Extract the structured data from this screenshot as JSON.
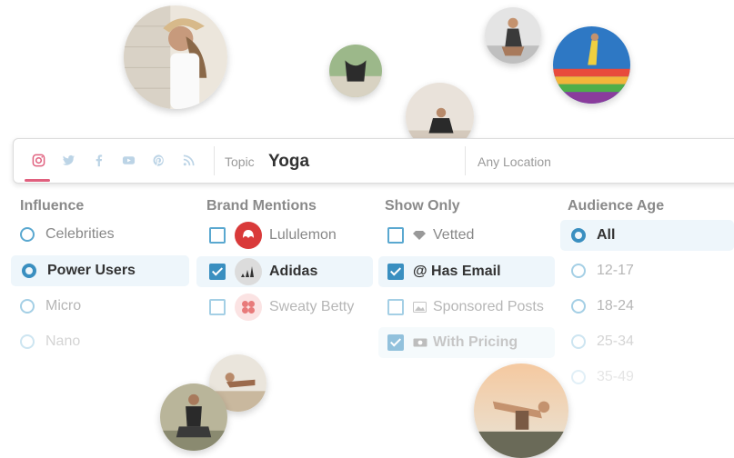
{
  "search": {
    "networks": [
      "instagram-icon",
      "twitter-icon",
      "facebook-icon",
      "youtube-icon",
      "pinterest-icon",
      "rss-icon"
    ],
    "topic_label": "Topic",
    "topic_value": "Yoga",
    "location_placeholder": "Any Location"
  },
  "filters": {
    "influence": {
      "title": "Influence",
      "options": [
        {
          "label": "Celebrities",
          "selected": false
        },
        {
          "label": "Power Users",
          "selected": true
        },
        {
          "label": "Micro",
          "selected": false
        },
        {
          "label": "Nano",
          "selected": false
        }
      ]
    },
    "brand_mentions": {
      "title": "Brand Mentions",
      "options": [
        {
          "label": "Lululemon",
          "checked": false,
          "icon": "lululemon-logo"
        },
        {
          "label": "Adidas",
          "checked": true,
          "icon": "adidas-logo"
        },
        {
          "label": "Sweaty Betty",
          "checked": false,
          "icon": "sweaty-betty-logo"
        }
      ]
    },
    "show_only": {
      "title": "Show Only",
      "options": [
        {
          "label": "Vetted",
          "checked": false,
          "icon": "diamond-icon"
        },
        {
          "label": "@ Has Email",
          "checked": true
        },
        {
          "label": "Sponsored Posts",
          "checked": false,
          "icon": "image-icon"
        },
        {
          "label": "With Pricing",
          "checked": true,
          "icon": "money-icon"
        }
      ]
    },
    "audience_age": {
      "title": "Audience Age",
      "options": [
        {
          "label": "All",
          "selected": true
        },
        {
          "label": "12-17",
          "selected": false
        },
        {
          "label": "18-24",
          "selected": false
        },
        {
          "label": "25-34",
          "selected": false
        },
        {
          "label": "35-49",
          "selected": false
        }
      ]
    }
  },
  "colors": {
    "accent": "#3a8fc0",
    "instagram_active": "#e0607e",
    "selected_bg": "#eef6fb"
  }
}
